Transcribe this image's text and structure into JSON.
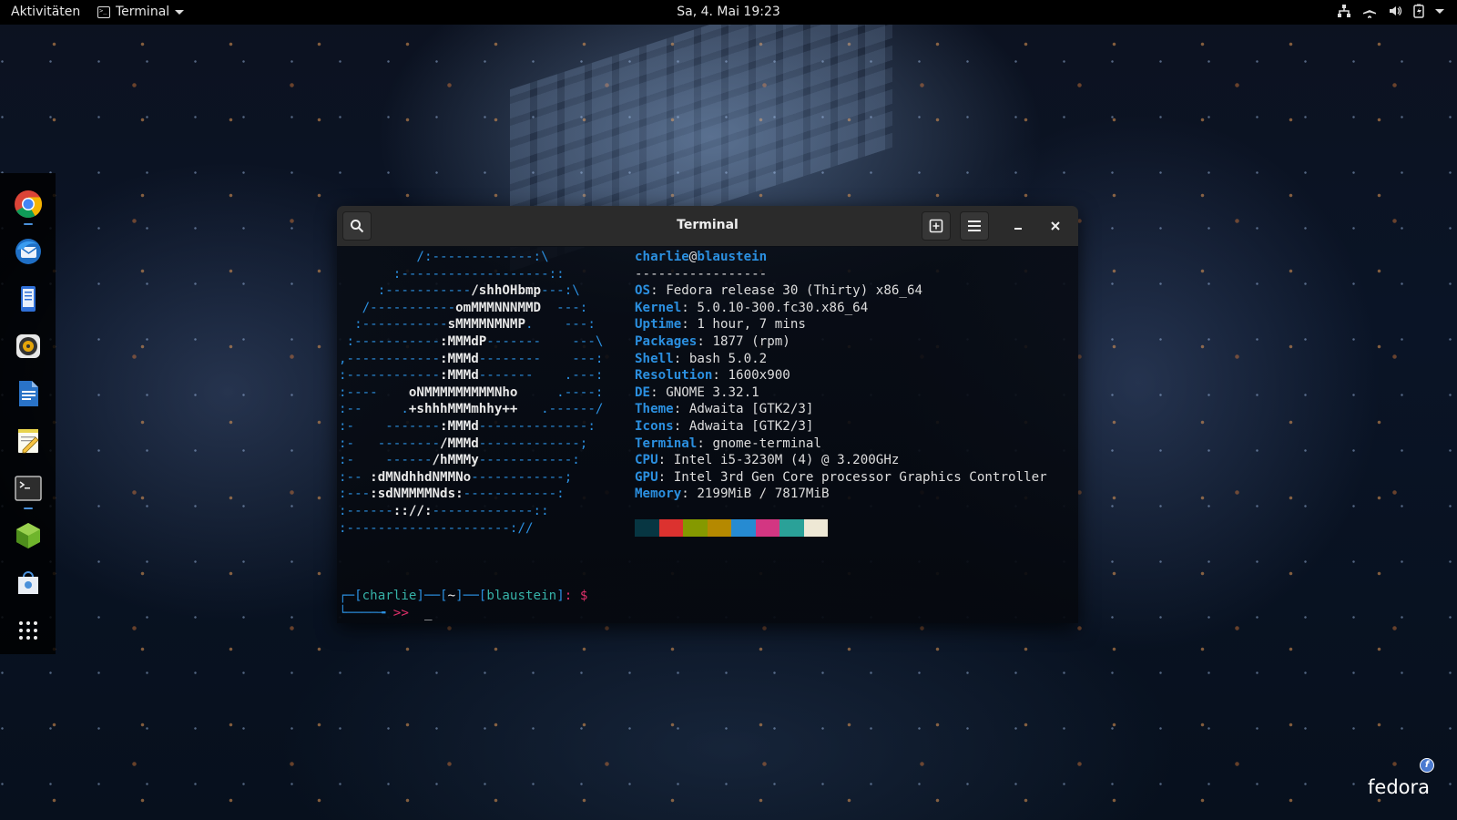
{
  "topbar": {
    "activities": "Aktivitäten",
    "app_name": "Terminal",
    "clock": "Sa, 4. Mai 19:23",
    "tray_icons": [
      "network-icon",
      "airplane-mode-icon",
      "volume-icon",
      "battery-icon",
      "system-menu-caret-icon"
    ]
  },
  "dock": {
    "items": [
      "chrome-icon",
      "thunderbird-icon",
      "phone-contacts-icon",
      "rhythmbox-icon",
      "writer-document-icon",
      "text-editor-icon",
      "terminal-icon",
      "cube-app-icon",
      "software-store-icon",
      "show-applications-icon"
    ]
  },
  "window": {
    "title": "Terminal"
  },
  "neofetch": {
    "user": "charlie",
    "at": "@",
    "host": "blaustein",
    "separator": "-----------------",
    "fields": [
      {
        "key": "OS",
        "value": "Fedora release 30 (Thirty) x86_64"
      },
      {
        "key": "Kernel",
        "value": "5.0.10-300.fc30.x86_64"
      },
      {
        "key": "Uptime",
        "value": "1 hour, 7 mins"
      },
      {
        "key": "Packages",
        "value": "1877 (rpm)"
      },
      {
        "key": "Shell",
        "value": "bash 5.0.2"
      },
      {
        "key": "Resolution",
        "value": "1600x900"
      },
      {
        "key": "DE",
        "value": "GNOME 3.32.1"
      },
      {
        "key": "Theme",
        "value": "Adwaita [GTK2/3]"
      },
      {
        "key": "Icons",
        "value": "Adwaita [GTK2/3]"
      },
      {
        "key": "Terminal",
        "value": "gnome-terminal"
      },
      {
        "key": "CPU",
        "value": "Intel i5-3230M (4) @ 3.200GHz"
      },
      {
        "key": "GPU",
        "value": "Intel 3rd Gen Core processor Graphics Controller"
      },
      {
        "key": "Memory",
        "value": "2199MiB / 7817MiB"
      }
    ],
    "palette": [
      "#073642",
      "#dc322f",
      "#859900",
      "#b58900",
      "#268bd2",
      "#d33682",
      "#2aa198",
      "#eee8d5"
    ]
  },
  "prompt": {
    "line1_user": "charlie",
    "line1_dir": "~",
    "line1_host": "blaustein",
    "line1_symbol": "$",
    "line2_arrows": ">>",
    "cursor": "_"
  },
  "branding": {
    "wordmark": "fedora",
    "badge": "f"
  },
  "colors": {
    "accent_blue": "#2b8fdf",
    "prompt_red": "#e0306a",
    "prompt_cyan": "#36b2a8"
  }
}
